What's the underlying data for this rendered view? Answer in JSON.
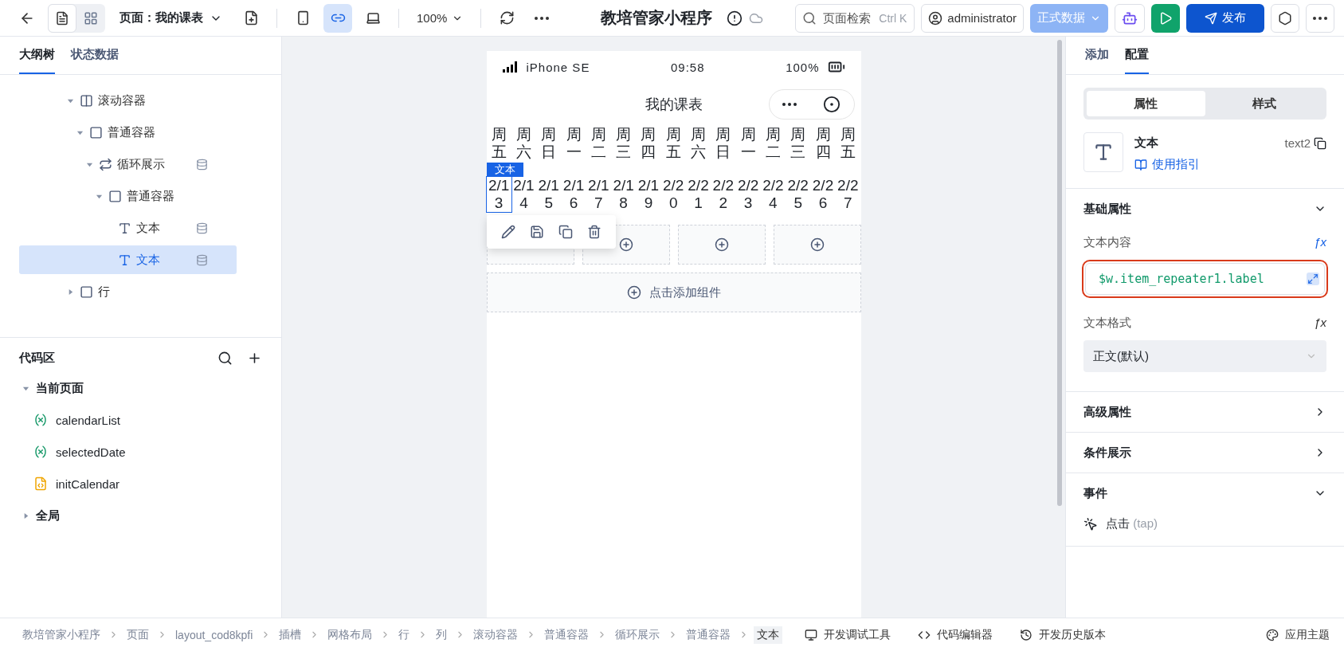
{
  "toolbar": {
    "views": [
      {
        "kind": "outline",
        "selected": true
      },
      {
        "kind": "layout",
        "selected": false
      }
    ],
    "page_select": "页面：我的课表",
    "devices": [
      {
        "kind": "phone",
        "selected": false
      },
      {
        "kind": "miniprogram",
        "selected": true
      },
      {
        "kind": "laptop",
        "selected": false
      }
    ],
    "zoom": "100%",
    "app_title": "教培管家小程序",
    "search": {
      "placeholder": "页面检索",
      "shortcut": "Ctrl K"
    },
    "user": "administrator",
    "data_source": "正式数据",
    "publish": "发布"
  },
  "outline": {
    "tabs": [
      {
        "label": "大纲树",
        "selected": true
      },
      {
        "label": "状态数据",
        "selected": false
      }
    ],
    "nodes": [
      {
        "label": "滚动容器",
        "kind": "scroll",
        "expanded": true,
        "bound": false,
        "selected": false,
        "children": [
          {
            "label": "普通容器",
            "kind": "container",
            "expanded": true,
            "bound": false,
            "selected": false,
            "children": [
              {
                "label": "循环展示",
                "kind": "loop",
                "expanded": true,
                "bound": true,
                "selected": false,
                "children": [
                  {
                    "label": "普通容器",
                    "kind": "container",
                    "expanded": true,
                    "bound": false,
                    "selected": false,
                    "children": [
                      {
                        "label": "文本",
                        "kind": "text",
                        "bound": true,
                        "selected": false
                      },
                      {
                        "label": "文本",
                        "kind": "text",
                        "bound": true,
                        "selected": true
                      }
                    ]
                  }
                ]
              }
            ]
          }
        ]
      },
      {
        "label": "行",
        "kind": "container",
        "expanded": false,
        "bound": false,
        "selected": false
      }
    ]
  },
  "code_area": {
    "title": "代码区",
    "groups": [
      {
        "label": "当前页面",
        "expanded": true,
        "items": [
          {
            "label": "calendarList",
            "kind": "variable"
          },
          {
            "label": "selectedDate",
            "kind": "variable"
          },
          {
            "label": "initCalendar",
            "kind": "script"
          }
        ]
      },
      {
        "label": "全局",
        "expanded": false
      }
    ]
  },
  "phone": {
    "device": "iPhone SE",
    "time": "09:58",
    "battery": "100%",
    "title": "我的课表",
    "selection_badge": "文本",
    "add_component": "点击添加组件",
    "days": [
      {
        "weekday": "周五",
        "date": "2/13",
        "selected": true
      },
      {
        "weekday": "周六",
        "date": "2/14",
        "selected": false
      },
      {
        "weekday": "周日",
        "date": "2/15",
        "selected": false
      },
      {
        "weekday": "周一",
        "date": "2/16",
        "selected": false
      },
      {
        "weekday": "周二",
        "date": "2/17",
        "selected": false
      },
      {
        "weekday": "周三",
        "date": "2/18",
        "selected": false
      },
      {
        "weekday": "周四",
        "date": "2/19",
        "selected": false
      },
      {
        "weekday": "周五",
        "date": "2/20",
        "selected": false
      },
      {
        "weekday": "周六",
        "date": "2/21",
        "selected": false
      },
      {
        "weekday": "周日",
        "date": "2/22",
        "selected": false
      },
      {
        "weekday": "周一",
        "date": "2/23",
        "selected": false
      },
      {
        "weekday": "周二",
        "date": "2/24",
        "selected": false
      },
      {
        "weekday": "周三",
        "date": "2/25",
        "selected": false
      },
      {
        "weekday": "周四",
        "date": "2/26",
        "selected": false
      },
      {
        "weekday": "周五",
        "date": "2/27",
        "selected": false
      }
    ]
  },
  "config": {
    "tabs": [
      {
        "label": "添加",
        "selected": false
      },
      {
        "label": "配置",
        "selected": true
      }
    ],
    "modes": [
      {
        "label": "属性",
        "selected": true
      },
      {
        "label": "样式",
        "selected": false
      }
    ],
    "component": {
      "name": "文本",
      "guide": "使用指引",
      "id": "text2"
    },
    "sections": [
      {
        "title": "基础属性",
        "expanded": true,
        "fields": [
          {
            "label": "文本内容",
            "fx": "ƒx",
            "kind": "code",
            "value": "$w.item_repeater1.label",
            "highlighted": true
          },
          {
            "label": "文本格式",
            "fx": "ƒx",
            "kind": "select",
            "value": "正文(默认)"
          }
        ]
      },
      {
        "title": "高级属性",
        "expanded": false
      },
      {
        "title": "条件展示",
        "expanded": false
      },
      {
        "title": "事件",
        "expanded": true,
        "events": [
          {
            "label": "点击",
            "hint": "(tap)"
          }
        ]
      }
    ]
  },
  "status_bar": {
    "breadcrumb": [
      {
        "label": "教培管家小程序",
        "selected": false
      },
      {
        "label": "页面",
        "selected": false
      },
      {
        "label": "layout_cod8kpfi",
        "selected": false
      },
      {
        "label": "插槽",
        "selected": false
      },
      {
        "label": "网格布局",
        "selected": false
      },
      {
        "label": "行",
        "selected": false
      },
      {
        "label": "列",
        "selected": false
      },
      {
        "label": "滚动容器",
        "selected": false
      },
      {
        "label": "普通容器",
        "selected": false
      },
      {
        "label": "循环展示",
        "selected": false
      },
      {
        "label": "普通容器",
        "selected": false
      },
      {
        "label": "文本",
        "selected": true
      }
    ],
    "tools": [
      {
        "kind": "debug",
        "label": "开发调试工具"
      },
      {
        "kind": "code",
        "label": "代码编辑器"
      },
      {
        "kind": "history",
        "label": "开发历史版本"
      },
      {
        "kind": "theme",
        "label": "应用主题"
      }
    ]
  }
}
